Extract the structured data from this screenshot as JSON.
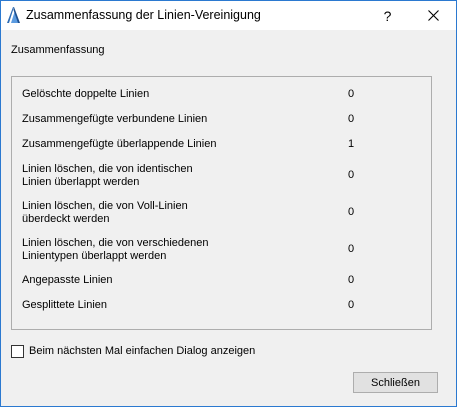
{
  "window": {
    "title": "Zusammenfassung der Linien-Vereinigung",
    "help_glyph": "?",
    "app_icon": "archicad-icon",
    "border_color": "#2b79d0"
  },
  "section": {
    "title": "Zusammenfassung"
  },
  "summary_rows": [
    {
      "label_line1": "Gelöschte doppelte Linien",
      "label_line2": "",
      "value": "0"
    },
    {
      "label_line1": "Zusammengefügte verbundene Linien",
      "label_line2": "",
      "value": "0"
    },
    {
      "label_line1": "Zusammengefügte überlappende Linien",
      "label_line2": "",
      "value": "1"
    },
    {
      "label_line1": "Linien löschen, die von identischen",
      "label_line2": "Linien überlappt werden",
      "value": "0"
    },
    {
      "label_line1": "Linien löschen, die von Voll-Linien",
      "label_line2": "überdeckt werden",
      "value": "0"
    },
    {
      "label_line1": "Linien löschen, die von verschiedenen",
      "label_line2": "Linientypen überlappt werden",
      "value": "0"
    },
    {
      "label_line1": "Angepasste Linien",
      "label_line2": "",
      "value": "0"
    },
    {
      "label_line1": "Gesplittete Linien",
      "label_line2": "",
      "value": "0"
    }
  ],
  "checkbox": {
    "label": "Beim nächsten Mal einfachen Dialog anzeigen",
    "checked": false
  },
  "buttons": {
    "close_label": "Schließen"
  }
}
